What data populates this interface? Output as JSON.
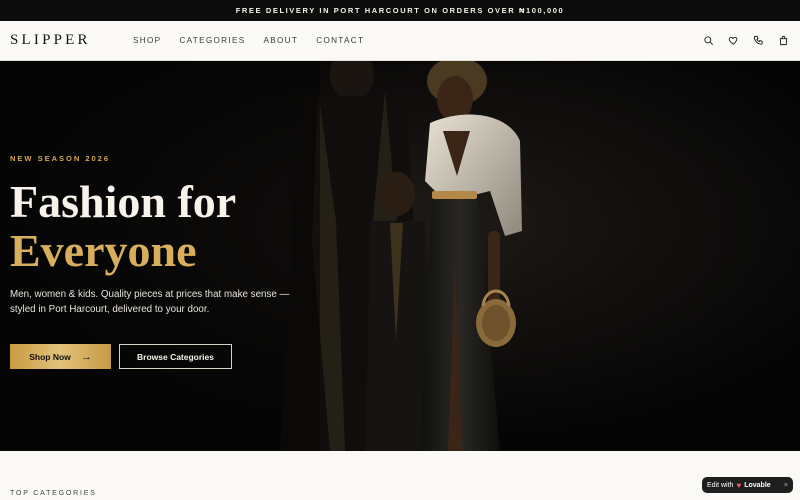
{
  "announcement": "FREE DELIVERY IN PORT HARCOURT ON ORDERS OVER ₦100,000",
  "brand": "SLIPPER",
  "nav": {
    "links": [
      "SHOP",
      "CATEGORIES",
      "ABOUT",
      "CONTACT"
    ],
    "icons": [
      "search-icon",
      "heart-icon",
      "phone-icon",
      "bag-icon"
    ]
  },
  "hero": {
    "eyebrow": "NEW SEASON 2026",
    "headline_line1": "Fashion for",
    "headline_line2": "Everyone",
    "subtext": "Men, women & kids. Quality pieces at prices that make sense — styled in Port Harcourt, delivered to your door.",
    "primary_button": "Shop Now",
    "secondary_button": "Browse Categories",
    "accent_color": "#d7ae5c"
  },
  "section_label": "TOP CATEGORIES",
  "badge": {
    "prefix": "Edit with",
    "brand": "Lovable",
    "close": "×"
  }
}
